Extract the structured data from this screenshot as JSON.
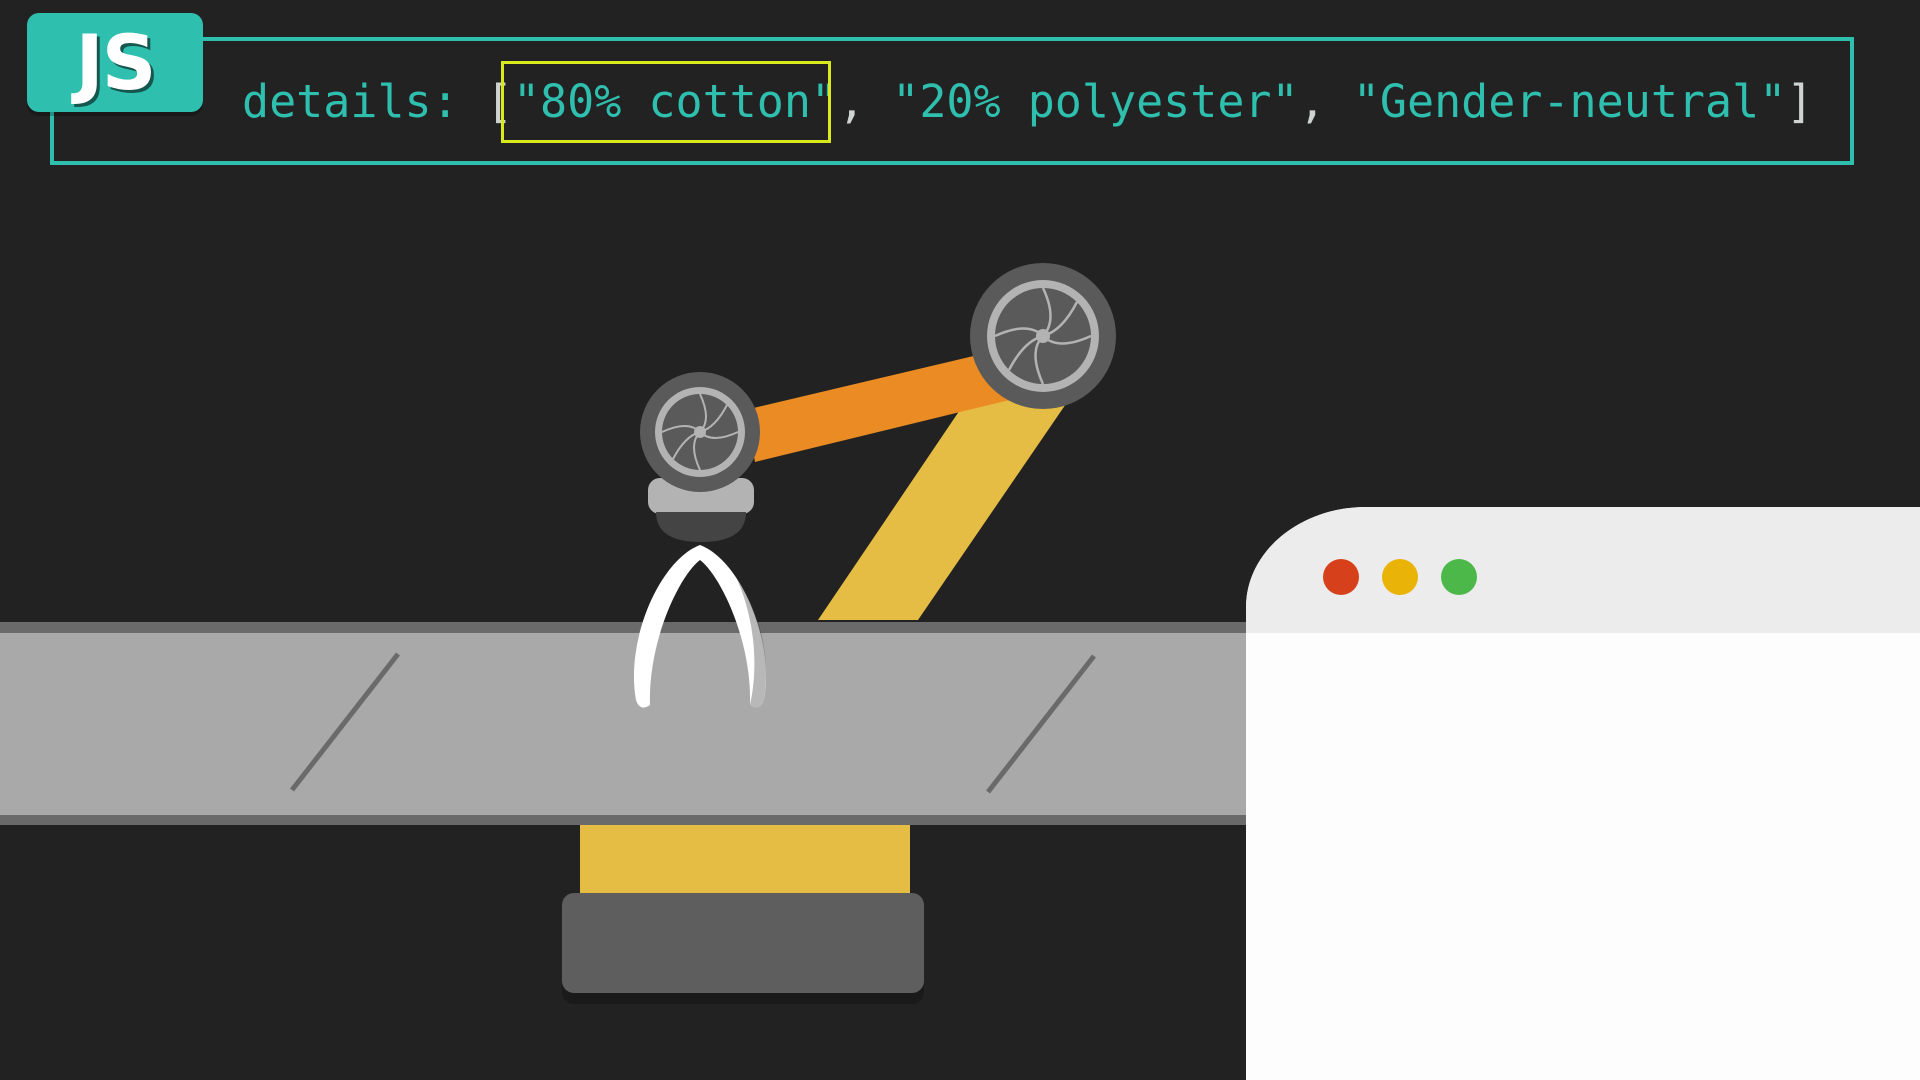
{
  "badge": {
    "label": "JS",
    "color": "#2fbfae"
  },
  "code": {
    "key": "details:",
    "open_bracket": "[",
    "items": [
      "\"80% cotton\"",
      "\"20% polyester\"",
      "\"Gender-neutral\""
    ],
    "separator": ",",
    "close_bracket": "]",
    "highlighted_item": "\"80% cotton\"",
    "text_color": "#2fbfae",
    "highlight_color": "#d8ea1c"
  },
  "colors": {
    "background": "#222222",
    "arm_orange": "#ea8c23",
    "arm_yellow": "#e6bd44",
    "joint_dark": "#5a5a5a",
    "joint_light": "#b3b3b3",
    "conveyor": "#a9a9a9",
    "conveyor_edge": "#6a6a6a",
    "base": "#5e5e5e"
  },
  "browser": {
    "buttons": [
      {
        "name": "close-dot",
        "color": "#d6411b"
      },
      {
        "name": "minimize-dot",
        "color": "#eab308"
      },
      {
        "name": "maximize-dot",
        "color": "#4cb84a"
      }
    ]
  }
}
